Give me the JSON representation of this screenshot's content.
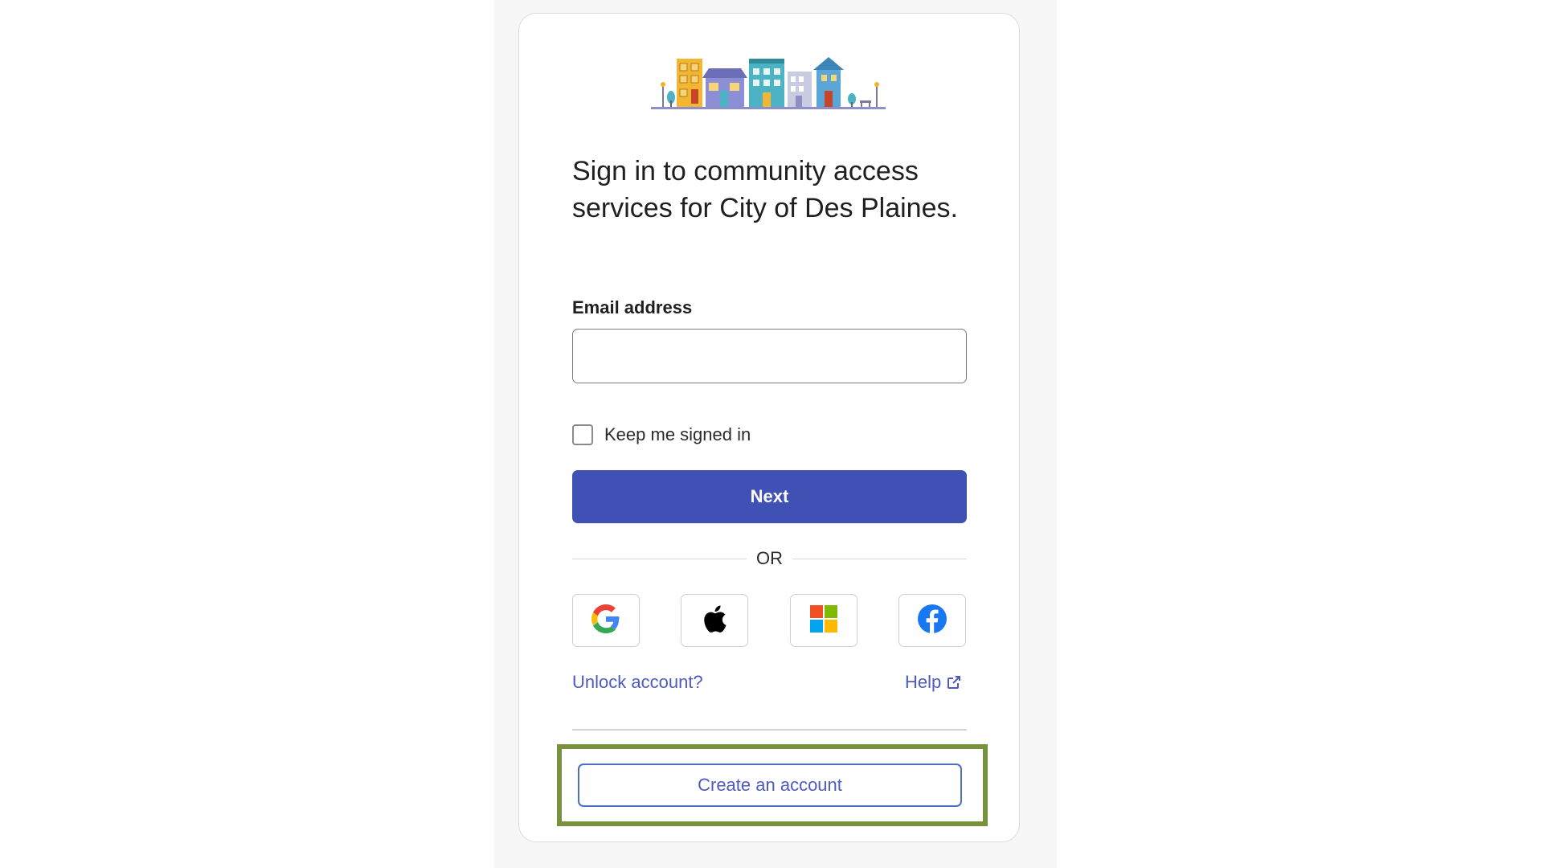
{
  "heading": "Sign in to community access services for City of Des Plaines.",
  "email": {
    "label": "Email address",
    "value": "",
    "placeholder": ""
  },
  "keep_signed_in": {
    "label": "Keep me signed in",
    "checked": false
  },
  "next_button": "Next",
  "or_text": "OR",
  "social_providers": [
    "google-icon",
    "apple-icon",
    "microsoft-icon",
    "facebook-icon"
  ],
  "links": {
    "unlock": "Unlock account?",
    "help": "Help"
  },
  "create_account": "Create an account",
  "colors": {
    "primary": "#3f51b5",
    "link": "#4d5bc0",
    "highlight": "#76923c"
  }
}
